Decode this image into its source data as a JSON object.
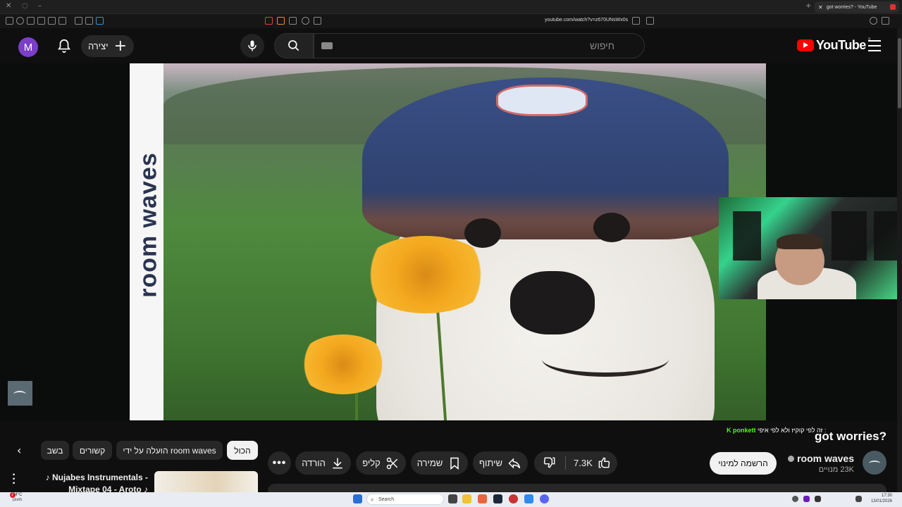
{
  "browser": {
    "tab_title": "got worries? - YouTube",
    "url": "youtube.com/watch?v=z670UNsWx0s"
  },
  "header": {
    "avatar_letter": "M",
    "create_label": "יצירה",
    "search_placeholder": "חיפוש",
    "logo_text": "YouTube",
    "country_code": "IL"
  },
  "video": {
    "overlay_text": "room waves",
    "title": "got worries?"
  },
  "live_chat": {
    "username": "ponkett",
    "message": "זה לפי קוקיז ולא לפי איפי :"
  },
  "channel": {
    "name": "room waves",
    "subscribers": "23K מנויים",
    "subscribe_label": "הרשמה למינוי"
  },
  "actions": {
    "likes": "7.3K",
    "share": "שיתוף",
    "save": "שמירה",
    "clip": "קליפ",
    "download": "הורדה"
  },
  "chips": {
    "all": "הכול",
    "uploaded_by": "הועלה על ידי room waves",
    "related": "קשורים",
    "recent": "בשב"
  },
  "recommendation": {
    "title": "♪ Nujabes Instrumentals - Mixtape 04 - Aroto ♪"
  },
  "taskbar": {
    "search_label": "Search",
    "weather_temp": "14°C",
    "weather_text": "מעונן",
    "time": "17:30",
    "date": "13/01/2026",
    "notification_count": "2"
  }
}
